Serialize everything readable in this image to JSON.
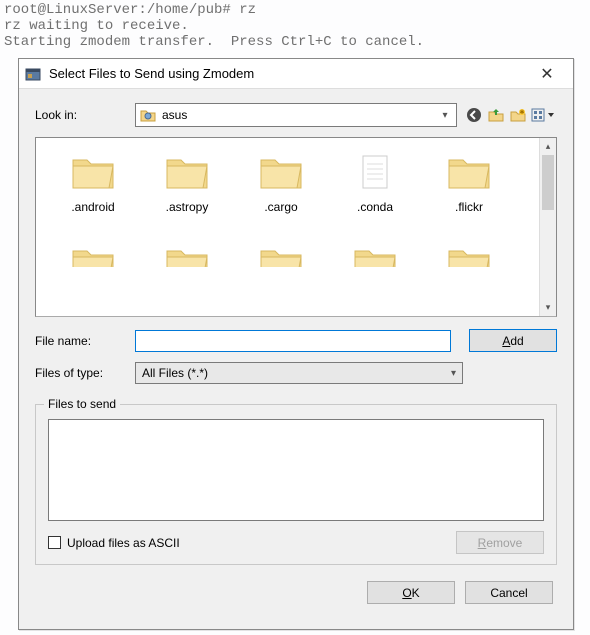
{
  "terminal": {
    "line1": "root@LinuxServer:/home/pub# rz",
    "line2": "rz waiting to receive.",
    "line3": "Starting zmodem transfer.  Press Ctrl+C to cancel."
  },
  "dialog": {
    "title": "Select Files to Send using Zmodem",
    "lookin_label": "Look in:",
    "lookin_value": "asus",
    "files": [
      {
        "name": ".android",
        "type": "folder"
      },
      {
        "name": ".astropy",
        "type": "folder"
      },
      {
        "name": ".cargo",
        "type": "folder"
      },
      {
        "name": ".conda",
        "type": "file"
      },
      {
        "name": ".flickr",
        "type": "folder"
      }
    ],
    "filename_label": "File name:",
    "filename_value": "",
    "add_label": "Add",
    "filetypes_label": "Files of type:",
    "filetypes_value": "All Files (*.*)",
    "group_label": "Files to send",
    "upload_ascii_label": "Upload files as ASCII",
    "upload_ascii_checked": false,
    "remove_label": "Remove",
    "ok_label": "OK",
    "cancel_label": "Cancel"
  },
  "icons": {
    "back": "back-icon",
    "up": "folder-up-icon",
    "new": "new-folder-icon",
    "view": "views-icon"
  }
}
